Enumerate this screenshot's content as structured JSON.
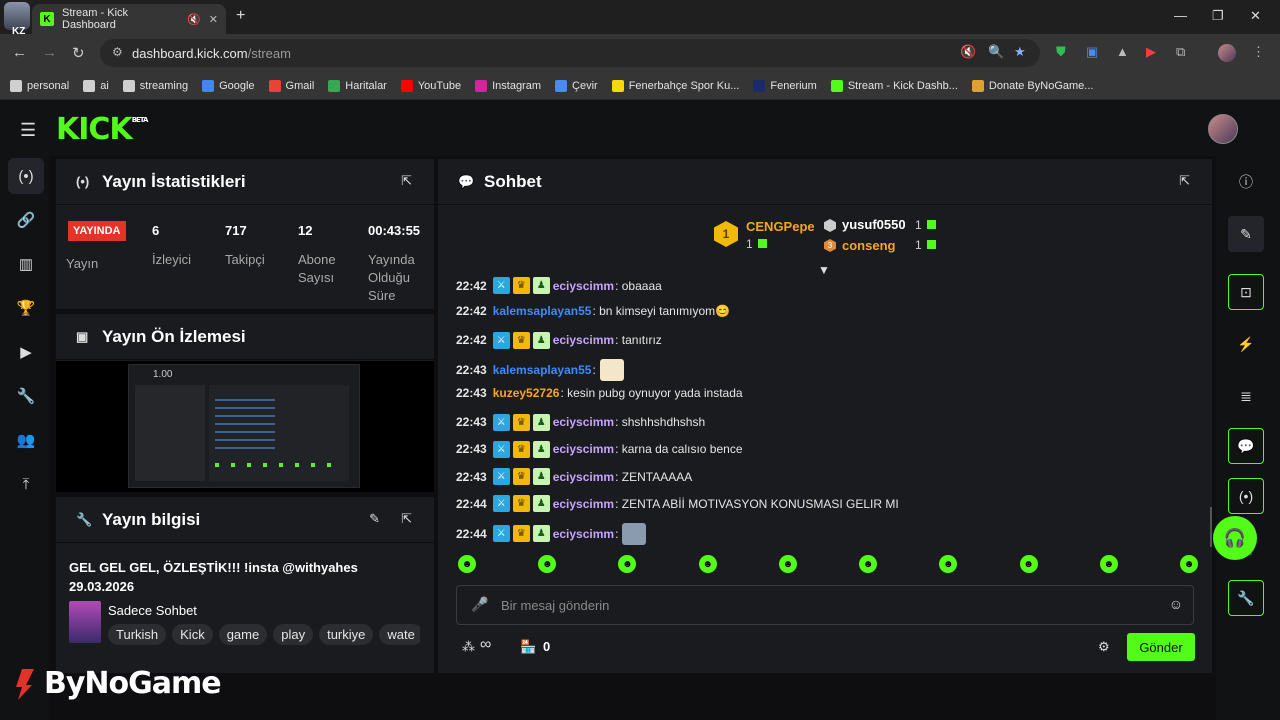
{
  "browser": {
    "tab_title": "Stream - Kick Dashboard",
    "url_host": "dashboard.kick.com",
    "url_path": "/stream",
    "profile_label": "KZ"
  },
  "bookmarks": [
    {
      "label": "personal",
      "icon": "folder-icon",
      "color": "#cfcfcf"
    },
    {
      "label": "ai",
      "icon": "folder-icon",
      "color": "#cfcfcf"
    },
    {
      "label": "streaming",
      "icon": "folder-icon",
      "color": "#cfcfcf"
    },
    {
      "label": "Google",
      "icon": "google-icon",
      "color": "#4285f4"
    },
    {
      "label": "Gmail",
      "icon": "google-icon",
      "color": "#ea4335"
    },
    {
      "label": "Haritalar",
      "icon": "maps-icon",
      "color": "#34a853"
    },
    {
      "label": "YouTube",
      "icon": "youtube-icon",
      "color": "#ff0000"
    },
    {
      "label": "Instagram",
      "icon": "instagram-icon",
      "color": "#d6249f"
    },
    {
      "label": "Çevir",
      "icon": "translate-icon",
      "color": "#4a8af4"
    },
    {
      "label": "Fenerbahçe Spor Ku...",
      "icon": "fenerbahce-icon",
      "color": "#f5d90a"
    },
    {
      "label": "Fenerium",
      "icon": "fenerium-icon",
      "color": "#1a2a6c"
    },
    {
      "label": "Stream - Kick Dashb...",
      "icon": "kick-icon",
      "color": "#53fc18"
    },
    {
      "label": "Donate ByNoGame...",
      "icon": "bynogame-icon",
      "color": "#e0a030"
    }
  ],
  "app": {
    "logo": "KICK",
    "logo_badge": "BETA",
    "accent": "#53fc18"
  },
  "stats_panel": {
    "title": "Yayın İstatistikleri",
    "live_badge": "YAYINDA",
    "live_label": "Yayın",
    "viewers_value": "6",
    "viewers_label": "İzleyici",
    "followers_value": "717",
    "followers_label": "Takipçi",
    "subs_value": "12",
    "subs_label": "Abone Sayısı",
    "uptime_value": "00:43:55",
    "uptime_label": "Yayında Olduğu Süre"
  },
  "preview_panel": {
    "title": "Yayın Ön İzlemesi",
    "preview_overlay": "1.00"
  },
  "info_panel": {
    "title": "Yayın bilgisi",
    "stream_title": "GEL GEL GEL, ÖZLEŞTİK!!! !insta @withyahes 29.03.2026",
    "category": "Sadece Sohbet",
    "tags": [
      "Turkish",
      "Kick",
      "game",
      "play",
      "turkiye",
      "wate"
    ]
  },
  "chat": {
    "title": "Sohbet",
    "leaderboard": {
      "first_name": "CENGPepe",
      "first_rank": "1",
      "first_count": "1",
      "second_name": "yusuf0550",
      "second_count": "1",
      "third_name": "conseng",
      "third_rank": "3",
      "third_count": "1"
    },
    "messages": [
      {
        "time": "22:42",
        "badges": true,
        "user": "eciyscimm",
        "color": "#c7a3ff",
        "text": ": obaaaa"
      },
      {
        "time": "22:42",
        "badges": false,
        "user": "kalemsaplayan55",
        "color": "#3d8bff",
        "text": ": bn kimseyi tanımıyom😊"
      },
      {
        "time": "22:42",
        "badges": true,
        "user": "eciyscimm",
        "color": "#c7a3ff",
        "text": ": tanıtırız"
      },
      {
        "time": "22:43",
        "badges": false,
        "user": "kalemsaplayan55",
        "color": "#3d8bff",
        "text": ":"
      },
      {
        "time": "22:43",
        "badges": false,
        "user": "kuzey52726",
        "color": "#f5a623",
        "text": ": kesin pubg oynuyor yada instada"
      },
      {
        "time": "22:43",
        "badges": true,
        "user": "eciyscimm",
        "color": "#c7a3ff",
        "text": ": shshhshdhshsh"
      },
      {
        "time": "22:43",
        "badges": true,
        "user": "eciyscimm",
        "color": "#c7a3ff",
        "text": ": karna da calısıo bence"
      },
      {
        "time": "22:43",
        "badges": true,
        "user": "eciyscimm",
        "color": "#c7a3ff",
        "text": ": ZENTAAAAA"
      },
      {
        "time": "22:44",
        "badges": true,
        "user": "eciyscimm",
        "color": "#c7a3ff",
        "text": ": ZENTA ABİİ MOTIVASYON KONUSMASI GELIR MI"
      },
      {
        "time": "22:44",
        "badges": true,
        "user": "eciyscimm",
        "color": "#c7a3ff",
        "text": ":"
      }
    ],
    "input_placeholder": "Bir mesaj gönderin",
    "points_value": "∞",
    "gifts_value": "0",
    "send_label": "Gönder"
  },
  "watermark": "ByNoGame"
}
